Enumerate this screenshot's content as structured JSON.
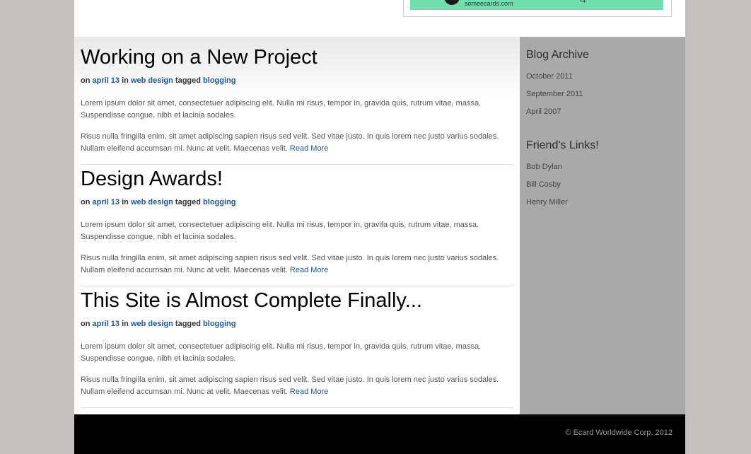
{
  "banner": {
    "text": "someecards.com",
    "colors": {
      "fill": "#6fdfb0"
    }
  },
  "posts": [
    {
      "title": "Working on a New Project",
      "meta": {
        "on": "on",
        "date": "april 13",
        "in": "in",
        "category": "web design",
        "tagged": "tagged",
        "tag": "blogging"
      },
      "p1": "Lorem ipsum dolor sit amet, consectetuer adipiscing elit. Nulla mi risus, tempor in, gravida quis, rutrum vitae, massa. Suspendisse congue, nibh et lacinia sodales.",
      "p2": "Risus nulla fringilla enim, sit amet adipiscing sapien risus sed velit. Sed vitae justo. In quis lorem nec justo varius sodales. Nullam eleifend accumsan mi. Nunc at velit. Maecenas velit.",
      "read_more": "Read More"
    },
    {
      "title": "Design Awards!",
      "meta": {
        "on": "on",
        "date": "april 13",
        "in": "in",
        "category": "web design",
        "tagged": "tagged",
        "tag": "blogging"
      },
      "p1": "Lorem ipsum dolor sit amet, consectetuer adipiscing elit. Nulla mi risus, tempor in, gravifa quis, rutrum vitae, massa. Suspendisse congue, nibh et lacinia sodales.",
      "p2": "Risus nulla fringilla enim, sit amet adipiscing sapien risus sed velit. Sed vitae justo. In quis lorem nec justo varius sodales. Nullam eleifend accumsan mi. Nunc at velit. Maecenas velit.",
      "read_more": "Read More"
    },
    {
      "title": "This Site is Almost Complete Finally...",
      "meta": {
        "on": "on",
        "date": "april 13",
        "in": "in",
        "category": "web design",
        "tagged": "tagged",
        "tag": "blogging"
      },
      "p1": "Lorem ipsum dolor sit amet, consectetuer adipiscing elit. Nulla mi risus, tempor in, gravida quis, rutrum vitae, massa. Suspendisse congue, nibh et lacinia sodales.",
      "p2": "Risus nulla fringilla enim, sit amet adipiscing sapien risus sed velit. Sed vitae justo. In quis lorem nec justo varius sodales. Nullam eleifend accumsan mi. Nunc at velit. Maecenas velit.",
      "read_more": "Read More"
    }
  ],
  "sidebar": {
    "archive_heading": "Blog Archive",
    "archive_links": [
      "October 2011",
      "September 2011",
      "April 2007"
    ],
    "friends_heading": "Friend's Links!",
    "friends_links": [
      "Bob Dylan",
      "Bill Cosby",
      "Henry Miller"
    ],
    "colors": {
      "background": "#a9a9a9"
    }
  },
  "footer": {
    "copyright": "© Ecard Worldwide Corp. 2012"
  },
  "colors": {
    "page_bg": "#c4c0bd",
    "link": "#21578f",
    "footer_bg": "#000000"
  }
}
